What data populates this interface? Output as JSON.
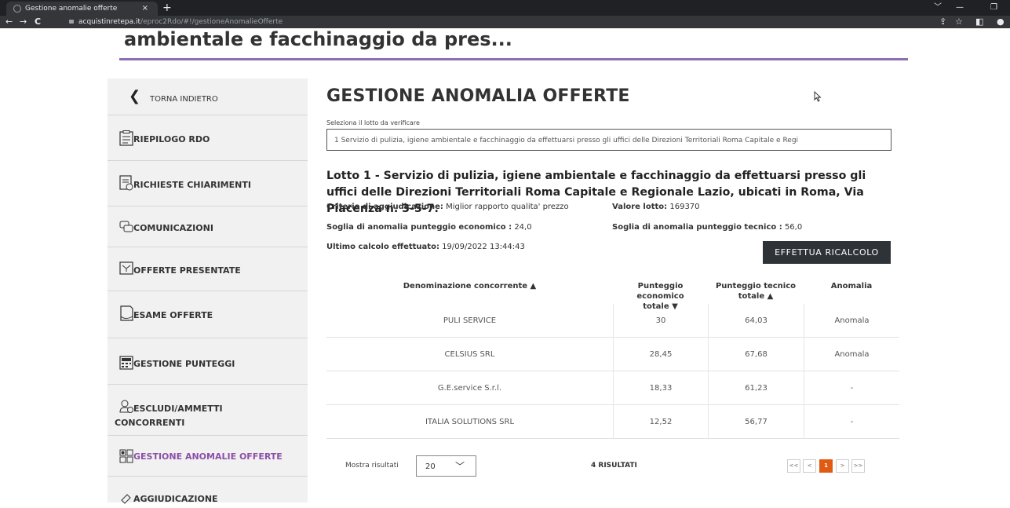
{
  "browser": {
    "tab_title": "Gestione anomalie offerte",
    "tab_close": "×",
    "new_tab": "+",
    "url_host": "acquistinretepa.it",
    "url_path": "/eproc2Rdo/#!/gestioneAnomalieOfferte"
  },
  "page": {
    "cut_title": "ambientale e facchinaggio da pres..."
  },
  "sidebar": {
    "back_label": "TORNA INDIETRO",
    "items": [
      {
        "label": "RIEPILOGO RDO"
      },
      {
        "label": "RICHIESTE CHIARIMENTI"
      },
      {
        "label": "COMUNICAZIONI"
      },
      {
        "label": "OFFERTE PRESENTATE"
      },
      {
        "label": "ESAME OFFERTE"
      },
      {
        "label": "GESTIONE PUNTEGGI"
      },
      {
        "label": "ESCLUDI/AMMETTI",
        "label2": "CONCORRENTI"
      },
      {
        "label": "GESTIONE ANOMALIE OFFERTE"
      },
      {
        "label": "AGGIUDICAZIONE"
      }
    ]
  },
  "main": {
    "title": "GESTIONE ANOMALIA OFFERTE",
    "select_label": "Seleziona il lotto da verificare",
    "select_value": "1 Servizio di pulizia, igiene ambientale e facchinaggio da effettuarsi presso gli uffici delle Direzioni Territoriali Roma Capitale e Regi",
    "lot_title": "Lotto 1 - Servizio di pulizia, igiene ambientale e facchinaggio da effettuarsi presso gli uffici delle Direzioni Territoriali Roma Capitale e Regionale Lazio, ubicati in Roma, Via Piacenza n. 3-5-7.",
    "criterio_label": "Criterio di aggiudicazione:",
    "criterio_value": "Miglior rapporto qualita' prezzo",
    "valore_label": "Valore lotto:",
    "valore_value": "169370",
    "soglia_eco_label": "Soglia di anomalia punteggio economico :",
    "soglia_eco_value": "24,0",
    "soglia_tec_label": "Soglia di anomalia punteggio tecnico :",
    "soglia_tec_value": "56,0",
    "ultimo_label": "Ultimo calcolo effettuato:",
    "ultimo_value": "19/09/2022 13:44:43",
    "recalc_button": "EFFETTUA RICALCOLO"
  },
  "table": {
    "headers": {
      "name": "Denominazione concorrente ▲",
      "eco_line1": "Punteggio economico",
      "eco_line2": "totale ▼",
      "tec_line1": "Punteggio tecnico",
      "tec_line2": "totale ▲",
      "anomaly": "Anomalia"
    },
    "rows": [
      {
        "name": "PULI SERVICE",
        "eco": "30",
        "tec": "64,03",
        "anomaly": "Anomala"
      },
      {
        "name": "CELSIUS SRL",
        "eco": "28,45",
        "tec": "67,68",
        "anomaly": "Anomala"
      },
      {
        "name": "G.E.service S.r.l.",
        "eco": "18,33",
        "tec": "61,23",
        "anomaly": "-"
      },
      {
        "name": "ITALIA SOLUTIONS SRL",
        "eco": "12,52",
        "tec": "56,77",
        "anomaly": "-"
      }
    ]
  },
  "pagination": {
    "mostra_label": "Mostra risultati",
    "page_size": "20",
    "results": "4 RISULTATI",
    "first": "<<",
    "prev": "<",
    "current": "1",
    "next": ">",
    "last": ">>"
  },
  "colors": {
    "accent_purple": "#8c6fb0",
    "active_item": "#8c4fa8",
    "button_dark": "#2e3338",
    "page_orange": "#e05a12"
  }
}
